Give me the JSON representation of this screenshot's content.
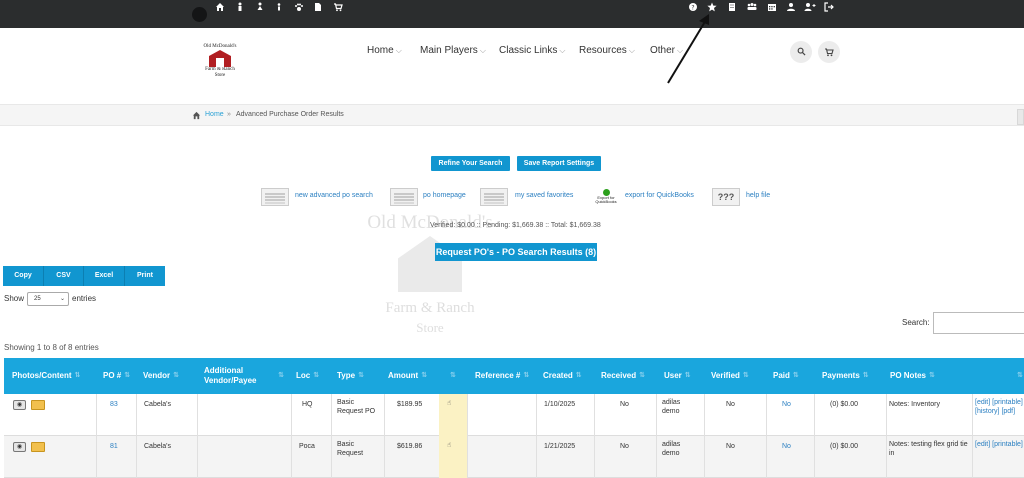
{
  "topbar": {
    "left_icons": [
      "home-icon",
      "person-icon",
      "person-female-icon",
      "person-child-icon",
      "paw-icon",
      "document-icon",
      "cart-icon"
    ],
    "right_icons": [
      "help-icon",
      "star-icon",
      "building-icon",
      "group-icon",
      "calendar-icon",
      "user-icon",
      "user-add-icon",
      "logout-icon"
    ]
  },
  "logo": {
    "line1": "Old McDonald's",
    "line2": "Farm & Ranch",
    "line3": "Store"
  },
  "nav": {
    "items": [
      "Home",
      "Main Players",
      "Classic Links",
      "Resources",
      "Other"
    ]
  },
  "breadcrumb": {
    "home": "Home",
    "separator": "»",
    "current": "Advanced Purchase Order Results"
  },
  "actions": {
    "refine": "Refine Your Search",
    "save_settings": "Save Report Settings"
  },
  "quick_links": {
    "new_search": "new advanced po search",
    "po_homepage": "po homepage",
    "saved_favorites": "my saved favorites",
    "quickbooks_badge": "Export for QuickBooks",
    "export_qb": "export for QuickBooks",
    "help_file": "help file",
    "help_glyph": "???"
  },
  "totals": "Verified: $0.00 :: Pending: $1,669.38 :: Total: $1,669.38",
  "result_title": "Request PO's - PO Search Results (8)",
  "watermark": {
    "line1": "Old McDonald's",
    "line2": "Farm & Ranch",
    "line3": "Store"
  },
  "export_buttons": [
    "Copy",
    "CSV",
    "Excel",
    "Print"
  ],
  "table_controls": {
    "show": "Show",
    "page_size": "25",
    "entries": "entries",
    "search_label": "Search:",
    "showing": "Showing 1 to 8 of 8 entries"
  },
  "table": {
    "headers": [
      "Photos/Content",
      "PO #",
      "Vendor",
      "Additional Vendor/Payee",
      "Loc",
      "Type",
      "Amount",
      "",
      "Reference #",
      "Created",
      "Received",
      "User",
      "Verified",
      "Paid",
      "Payments",
      "PO Notes",
      ""
    ],
    "rows": [
      {
        "po": "83",
        "vendor": "Cabela's",
        "additional": "",
        "loc": "HQ",
        "type": "Basic Request PO",
        "amount": "$189.95",
        "reference": "",
        "created": "1/10/2025",
        "received": "No",
        "user": "adilas demo",
        "verified": "No",
        "paid": "No",
        "payments": "(0) $0.00",
        "notes": "Notes: Inventory",
        "actions": "[edit] [printable] [history] [pdf]"
      },
      {
        "po": "81",
        "vendor": "Cabela's",
        "additional": "",
        "loc": "Poca",
        "type": "Basic Request",
        "amount": "$619.86",
        "reference": "",
        "created": "1/21/2025",
        "received": "No",
        "user": "adilas demo",
        "verified": "No",
        "paid": "No",
        "payments": "(0) $0.00",
        "notes": "Notes: testing flex grid tie in",
        "actions": "[edit] [printable]"
      }
    ]
  }
}
